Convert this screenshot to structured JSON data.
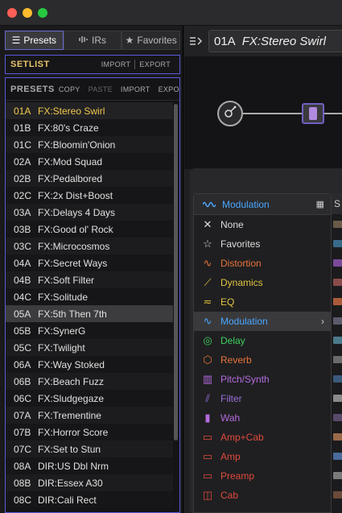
{
  "window": {
    "traffic_lights": [
      "close",
      "minimize",
      "zoom"
    ]
  },
  "left_panel": {
    "tabs": [
      {
        "label": "Presets",
        "icon": "list-icon",
        "active": true
      },
      {
        "label": "IRs",
        "icon": "waveform-icon",
        "active": false
      },
      {
        "label": "Favorites",
        "icon": "star-icon",
        "active": false
      }
    ],
    "setlist": {
      "title": "SETLIST",
      "import": "IMPORT",
      "export": "EXPORT"
    },
    "presets": {
      "title": "PRESETS",
      "copy": "COPY",
      "paste": "PASTE",
      "import": "IMPORT",
      "export": "EXPORT",
      "items": [
        {
          "id": "01A",
          "name": "FX:Stereo Swirl"
        },
        {
          "id": "01B",
          "name": "FX:80's Craze"
        },
        {
          "id": "01C",
          "name": "FX:Bloomin'Onion"
        },
        {
          "id": "02A",
          "name": "FX:Mod Squad"
        },
        {
          "id": "02B",
          "name": "FX:Pedalbored"
        },
        {
          "id": "02C",
          "name": "FX:2x Dist+Boost"
        },
        {
          "id": "03A",
          "name": "FX:Delays 4 Days"
        },
        {
          "id": "03B",
          "name": "FX:Good ol' Rock"
        },
        {
          "id": "03C",
          "name": "FX:Microcosmos"
        },
        {
          "id": "04A",
          "name": "FX:Secret Ways"
        },
        {
          "id": "04B",
          "name": "FX:Soft Filter"
        },
        {
          "id": "04C",
          "name": "FX:Solitude"
        },
        {
          "id": "05A",
          "name": "FX:5th Then 7th"
        },
        {
          "id": "05B",
          "name": "FX:SynerG"
        },
        {
          "id": "05C",
          "name": "FX:Twilight"
        },
        {
          "id": "06A",
          "name": "FX:Way Stoked"
        },
        {
          "id": "06B",
          "name": "FX:Beach Fuzz"
        },
        {
          "id": "06C",
          "name": "FX:Sludgegaze"
        },
        {
          "id": "07A",
          "name": "FX:Trementine"
        },
        {
          "id": "07B",
          "name": "FX:Horror Score"
        },
        {
          "id": "07C",
          "name": "FX:Set to Stun"
        },
        {
          "id": "08A",
          "name": "DIR:US Dbl Nrm"
        },
        {
          "id": "08B",
          "name": "DIR:Essex A30"
        },
        {
          "id": "08C",
          "name": "DIR:Cali Rect"
        }
      ]
    }
  },
  "preset_bar": {
    "id": "01A",
    "name": "FX:Stereo Swirl"
  },
  "category_menu": {
    "title": "Modulation",
    "items": [
      {
        "label": "None",
        "icon": "close-icon",
        "color": "#dddddd"
      },
      {
        "label": "Favorites",
        "icon": "star-icon",
        "color": "#dddddd"
      },
      {
        "label": "Distortion",
        "icon": "distortion-icon",
        "color": "#e8743b"
      },
      {
        "label": "Dynamics",
        "icon": "dynamics-icon",
        "color": "#e0c341"
      },
      {
        "label": "EQ",
        "icon": "eq-icon",
        "color": "#e0c341"
      },
      {
        "label": "Modulation",
        "icon": "modulation-icon",
        "color": "#4aa6ff",
        "active": true
      },
      {
        "label": "Delay",
        "icon": "delay-icon",
        "color": "#3fcf5e"
      },
      {
        "label": "Reverb",
        "icon": "reverb-icon",
        "color": "#e8743b"
      },
      {
        "label": "Pitch/Synth",
        "icon": "pitch-synth-icon",
        "color": "#b56be0"
      },
      {
        "label": "Filter",
        "icon": "filter-icon",
        "color": "#9a6fd8"
      },
      {
        "label": "Wah",
        "icon": "wah-icon",
        "color": "#b56be0"
      },
      {
        "label": "Amp+Cab",
        "icon": "amp-cab-icon",
        "color": "#e04a3b"
      },
      {
        "label": "Amp",
        "icon": "amp-icon",
        "color": "#e04a3b"
      },
      {
        "label": "Preamp",
        "icon": "preamp-icon",
        "color": "#e04a3b"
      },
      {
        "label": "Cab",
        "icon": "cab-icon",
        "color": "#e04a3b"
      }
    ]
  },
  "side_column": {
    "header": "S"
  }
}
